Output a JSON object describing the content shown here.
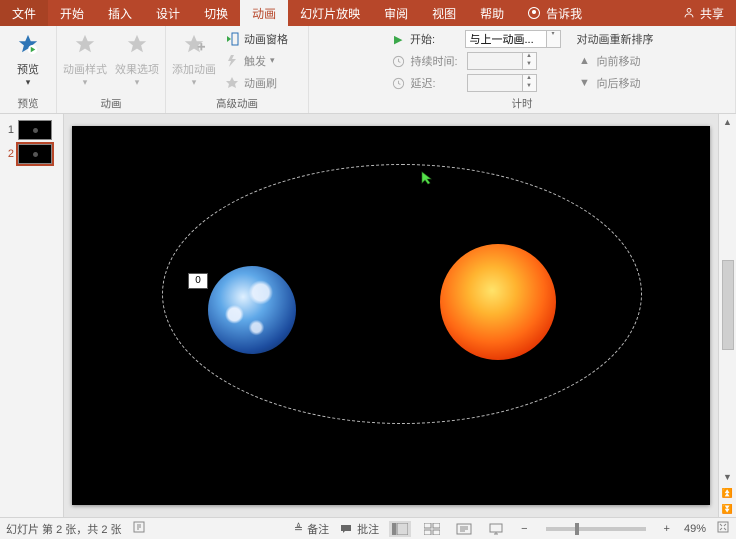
{
  "tabs": {
    "file": "文件",
    "home": "开始",
    "insert": "插入",
    "design": "设计",
    "transition": "切换",
    "animation": "动画",
    "slideshow": "幻灯片放映",
    "review": "审阅",
    "view": "视图",
    "help": "帮助",
    "tell": "告诉我",
    "share": "共享"
  },
  "ribbon": {
    "preview": {
      "label": "预览",
      "group": "预览"
    },
    "animation": {
      "style": "动画样式",
      "options": "效果选项",
      "group": "动画"
    },
    "advanced": {
      "add": "添加动画",
      "pane": "动画窗格",
      "trigger": "触发",
      "painter": "动画刷",
      "group": "高级动画"
    },
    "timing": {
      "start": "开始:",
      "start_value": "与上一动画...",
      "duration": "持续时间:",
      "duration_value": "",
      "delay": "延迟:",
      "delay_value": "",
      "reorder": "对动画重新排序",
      "forward": "向前移动",
      "backward": "向后移动",
      "group": "计时"
    }
  },
  "thumbs": [
    "1",
    "2"
  ],
  "slide": {
    "tag": "0"
  },
  "status": {
    "slide_info": "幻灯片 第 2 张，共 2 张",
    "notes": "备注",
    "comments": "批注",
    "zoom": "49%"
  },
  "icons": {
    "chev": "▾",
    "play": "▶",
    "up": "▲",
    "down": "▼",
    "left": "◀",
    "right": "▶",
    "dbl_up": "⏫",
    "dbl_down": "⏬",
    "minus": "−",
    "plus": "+"
  }
}
